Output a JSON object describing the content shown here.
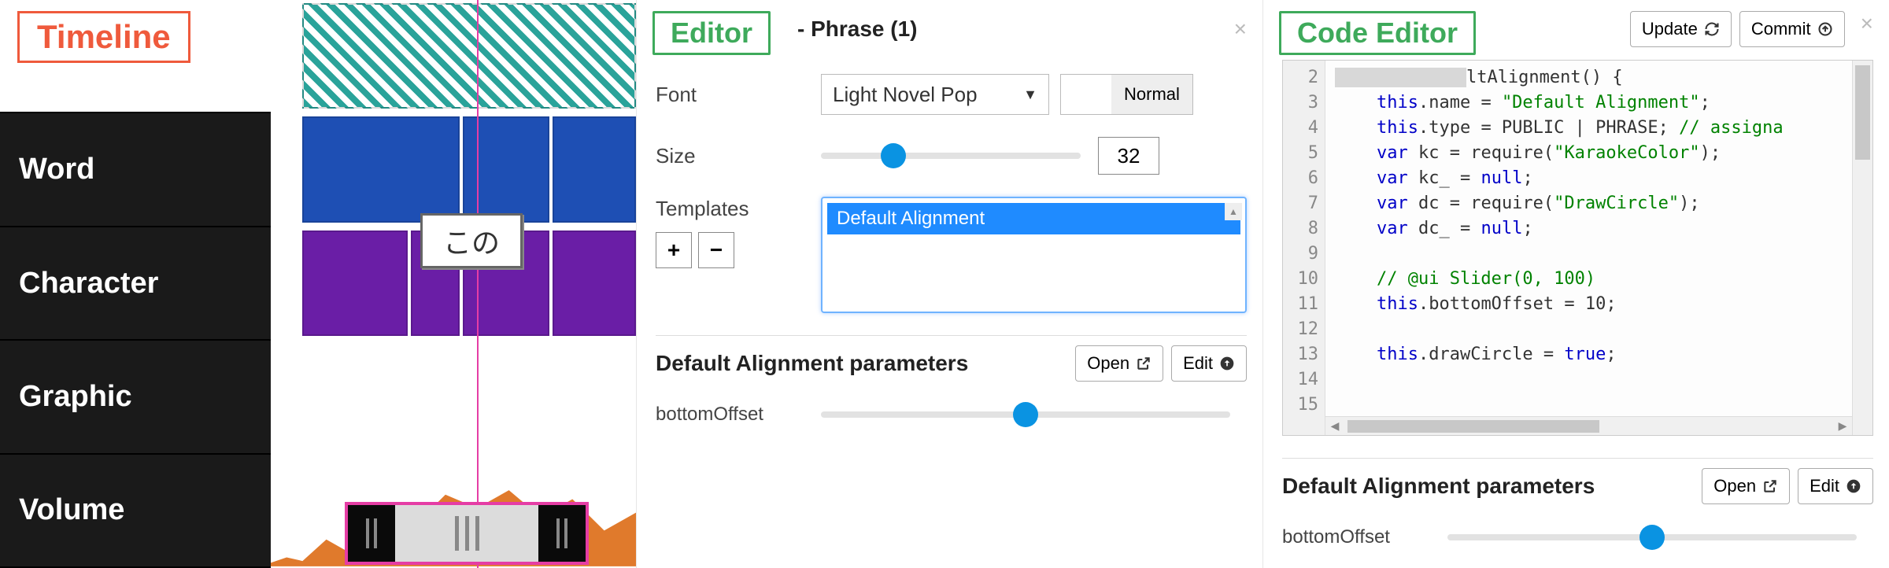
{
  "timeline": {
    "badge_label": "Timeline",
    "tracks": [
      "Word",
      "Character",
      "Graphic",
      "Volume"
    ],
    "tooltip_text": "この"
  },
  "editor": {
    "badge_label": "Editor",
    "title_suffix": "- Phrase (1)",
    "font": {
      "label": "Font",
      "selected": "Light Novel Pop",
      "style_normal": "Normal"
    },
    "size": {
      "label": "Size",
      "value": "32",
      "slider_pct": 28
    },
    "templates": {
      "label": "Templates",
      "add_label": "+",
      "remove_label": "−",
      "items": [
        "Default Alignment"
      ]
    },
    "params": {
      "title": "Default Alignment parameters",
      "open_label": "Open",
      "edit_label": "Edit",
      "bottomOffset": {
        "label": "bottomOffset",
        "slider_pct": 50
      }
    }
  },
  "code_editor": {
    "badge_label": "Code Editor",
    "update_label": "Update",
    "commit_label": "Commit",
    "gutter_lines": [
      "2",
      "3",
      "4",
      "5",
      "6",
      "7",
      "8",
      "9",
      "10",
      "11",
      "12",
      "13",
      "14",
      "15"
    ],
    "code": {
      "l1a": "ltAlignment() {",
      "l3_name": "this",
      "l3_b": ".name = ",
      "l3_s": "\"Default Alignment\"",
      "l3_e": ";",
      "l4_b": ".type = PUBLIC | PHRASE; ",
      "l4_c": "// assigna",
      "l5_kw": "var",
      "l5_b": " kc = require(",
      "l5_s": "\"KaraokeColor\"",
      "l5_e": ");",
      "l6_b": " kc_ = ",
      "l6_kw2": "null",
      "l6_e": ";",
      "l7_b": " dc = require(",
      "l7_s": "\"DrawCircle\"",
      "l7_e": ");",
      "l8_b": " dc_ = ",
      "l10_c": "// @ui Slider(0, 100)",
      "l11_b": ".bottomOffset = 10;",
      "l13_b": ".drawCircle = ",
      "l13_kw": "true",
      "l13_e": ";"
    },
    "params": {
      "title": "Default Alignment parameters",
      "open_label": "Open",
      "edit_label": "Edit",
      "bottomOffset": {
        "label": "bottomOffset",
        "slider_pct": 50
      }
    }
  }
}
